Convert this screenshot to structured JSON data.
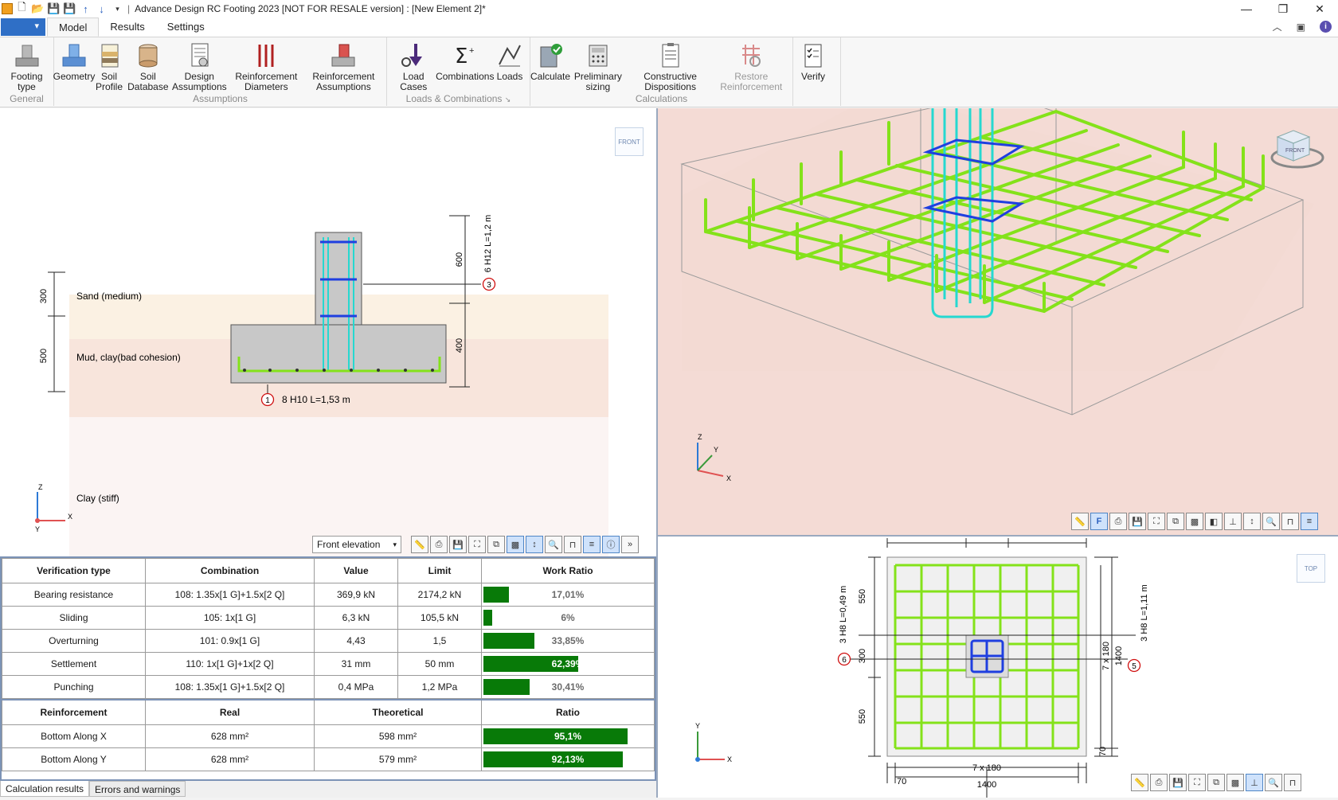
{
  "window": {
    "title": "Advance Design RC Footing 2023 [NOT FOR RESALE version] : [New Element 2]*",
    "controls": [
      "—",
      "❐",
      "✕"
    ]
  },
  "tabs": [
    "Model",
    "Results",
    "Settings"
  ],
  "ribbon": {
    "groups": [
      {
        "label": "General",
        "buttons": [
          {
            "label": "Footing type",
            "icon": "footing-type-icon"
          }
        ]
      },
      {
        "label": "Assumptions",
        "buttons": [
          {
            "label": "Geometry",
            "icon": "geometry-icon"
          },
          {
            "label": "Soil Profile",
            "icon": "soil-profile-icon"
          },
          {
            "label": "Soil Database",
            "icon": "soil-database-icon"
          },
          {
            "label": "Design Assumptions",
            "icon": "design-assumptions-icon"
          },
          {
            "label": "Reinforcement Diameters",
            "icon": "reinforcement-diameters-icon"
          },
          {
            "label": "Reinforcement Assumptions",
            "icon": "reinforcement-assumptions-icon"
          }
        ]
      },
      {
        "label": "Loads & Combinations",
        "buttons": [
          {
            "label": "Load Cases",
            "icon": "load-cases-icon"
          },
          {
            "label": "Combinations",
            "icon": "combinations-icon"
          },
          {
            "label": "Loads",
            "icon": "loads-icon"
          }
        ]
      },
      {
        "label": "Calculations",
        "buttons": [
          {
            "label": "Calculate",
            "icon": "calculate-icon"
          },
          {
            "label": "Preliminary sizing",
            "icon": "preliminary-sizing-icon"
          },
          {
            "label": "Constructive Dispositions",
            "icon": "constructive-dispositions-icon"
          },
          {
            "label": "Restore Reinforcement",
            "icon": "restore-reinforcement-icon"
          }
        ]
      },
      {
        "label": "",
        "buttons": [
          {
            "label": "Verify",
            "icon": "verify-icon"
          }
        ]
      }
    ]
  },
  "front_view": {
    "cube_label": "FRONT",
    "soil_layers": [
      {
        "name": "Sand (medium)",
        "thickness": "300",
        "color": "#fbf1e3"
      },
      {
        "name": "Mud, clay(bad cohesion)",
        "thickness": "500",
        "color": "#f8e5dc"
      },
      {
        "name": "Clay (stiff)",
        "thickness": "",
        "color": "#fbf4f3"
      }
    ],
    "dims": {
      "column_height": "600",
      "footing_height": "400"
    },
    "rebar_labels": {
      "bottom": {
        "mark": "1",
        "text": "8 H10 L=1,53 m"
      },
      "column": {
        "mark": "3",
        "text": "6 H12 L=1,2 m"
      }
    },
    "axes": {
      "z": "Z",
      "y": "Y",
      "x": "X"
    },
    "toolbar": {
      "view_select": "Front elevation"
    }
  },
  "top_view": {
    "cube_label": "TOP",
    "dims": {
      "side": "550",
      "mid": "300",
      "side2": "550",
      "total": "1400",
      "spacing": "7 x 180",
      "edge": "70"
    },
    "rebar_labels": {
      "left": {
        "mark": "6",
        "text": "3 H8 L=0,49 m"
      },
      "right": {
        "mark": "5",
        "text": "3 H8 L=1,11 m"
      }
    },
    "axes": {
      "y": "Y",
      "x": "X"
    }
  },
  "iso_view": {
    "axes": {
      "z": "Z",
      "y": "Y",
      "x": "X"
    },
    "cube_label": "FRONT"
  },
  "verification": {
    "headers": [
      "Verification type",
      "Combination",
      "Value",
      "Limit",
      "Work Ratio"
    ],
    "rows": [
      {
        "type": "Bearing resistance",
        "combination": "108: 1.35x[1 G]+1.5x[2 Q]",
        "value": "369,9 kN",
        "limit": "2174,2 kN",
        "ratio_label": "17,01%",
        "ratio": 0.1701
      },
      {
        "type": "Sliding",
        "combination": "105: 1x[1 G]",
        "value": "6,3 kN",
        "limit": "105,5 kN",
        "ratio_label": "6%",
        "ratio": 0.06
      },
      {
        "type": "Overturning",
        "combination": "101: 0.9x[1 G]",
        "value": "4,43",
        "limit": "1,5",
        "ratio_label": "33,85%",
        "ratio": 0.3385
      },
      {
        "type": "Settlement",
        "combination": "110: 1x[1 G]+1x[2 Q]",
        "value": "31 mm",
        "limit": "50 mm",
        "ratio_label": "62,39%",
        "ratio": 0.6239
      },
      {
        "type": "Punching",
        "combination": "108: 1.35x[1 G]+1.5x[2 Q]",
        "value": "0,4 MPa",
        "limit": "1,2 MPa",
        "ratio_label": "30,41%",
        "ratio": 0.3041
      }
    ]
  },
  "reinforcement": {
    "headers": [
      "Reinforcement",
      "Real",
      "Theoretical",
      "Ratio"
    ],
    "rows": [
      {
        "type": "Bottom Along X",
        "real": "628 mm²",
        "theoretical": "598 mm²",
        "ratio_label": "95,1%",
        "ratio": 0.951
      },
      {
        "type": "Bottom Along Y",
        "real": "628 mm²",
        "theoretical": "579 mm²",
        "ratio_label": "92,13%",
        "ratio": 0.9213
      }
    ]
  },
  "bottom_tabs": [
    "Calculation results",
    "Errors and warnings"
  ]
}
